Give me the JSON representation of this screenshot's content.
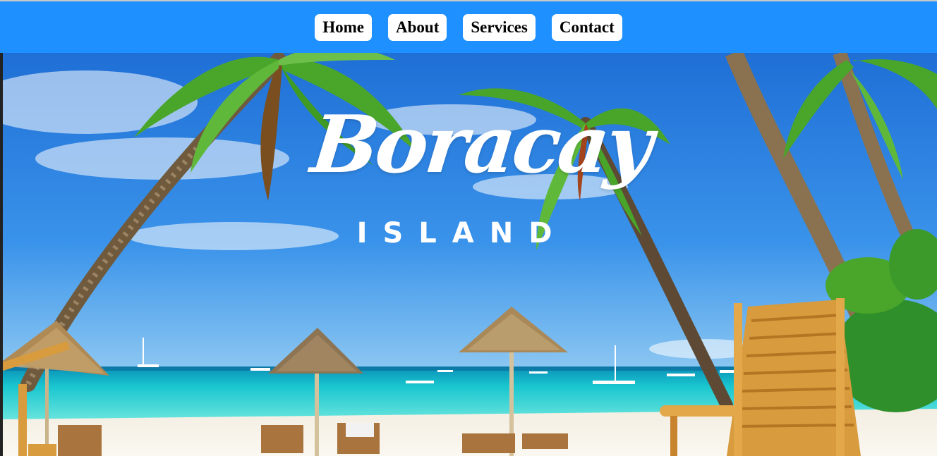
{
  "nav": {
    "items": [
      {
        "label": "Home"
      },
      {
        "label": "About"
      },
      {
        "label": "Services"
      },
      {
        "label": "Contact"
      }
    ]
  },
  "hero": {
    "title": "Boracay",
    "subtitle": "ISLAND"
  },
  "colors": {
    "nav_bar": "#1e90ff",
    "nav_button": "#ffffff",
    "sky": "#2f7fe0",
    "sea": "#1fd0d0",
    "sand": "#f7f3ea"
  }
}
